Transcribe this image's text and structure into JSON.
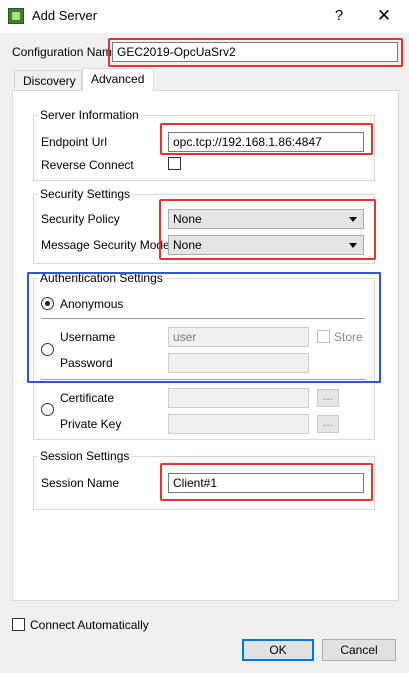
{
  "window": {
    "title": "Add Server",
    "help_label": "?",
    "close_label": "✕"
  },
  "config": {
    "label": "Configuration Name",
    "value": "GEC2019-OpcUaSrv2"
  },
  "tabs": [
    {
      "label": "Discovery"
    },
    {
      "label": "Advanced"
    }
  ],
  "server_info": {
    "title": "Server Information",
    "endpoint_label": "Endpoint Url",
    "endpoint_value": "opc.tcp://192.168.1.86:4847",
    "reverse_label": "Reverse Connect"
  },
  "security": {
    "title": "Security Settings",
    "policy_label": "Security Policy",
    "policy_value": "None",
    "mode_label": "Message Security Mode",
    "mode_value": "None"
  },
  "auth": {
    "title": "Authentication Settings",
    "anonymous_label": "Anonymous",
    "username_label": "Username",
    "username_value": "user",
    "store_label": "Store",
    "password_label": "Password",
    "certificate_label": "Certificate",
    "private_key_label": "Private Key",
    "browse_label": "..."
  },
  "session": {
    "title": "Session Settings",
    "name_label": "Session Name",
    "name_value": "Client#1"
  },
  "footer": {
    "connect_auto_label": "Connect Automatically",
    "ok_label": "OK",
    "cancel_label": "Cancel"
  },
  "colors": {
    "highlight_red": "#e03535",
    "highlight_blue": "#3355d0",
    "default_button_border": "#0078d7"
  }
}
